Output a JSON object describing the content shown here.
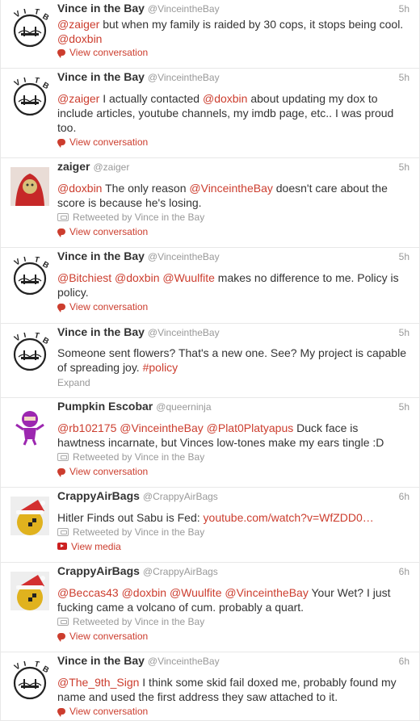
{
  "tweets": [
    {
      "name": "Vince in the Bay",
      "handle": "@VinceintheBay",
      "time": "5h",
      "avatar": "vitb-logo",
      "segments": [
        {
          "t": "mention",
          "v": "@zaiger"
        },
        {
          "t": "text",
          "v": " but when my family is raided by 30 cops, it stops being cool. "
        },
        {
          "t": "mention",
          "v": "@doxbin"
        }
      ],
      "action": "View conversation"
    },
    {
      "name": "Vince in the Bay",
      "handle": "@VinceintheBay",
      "time": "5h",
      "avatar": "vitb-logo",
      "segments": [
        {
          "t": "mention",
          "v": "@zaiger"
        },
        {
          "t": "text",
          "v": "  I actually contacted "
        },
        {
          "t": "mention",
          "v": "@doxbin"
        },
        {
          "t": "text",
          "v": " about updating my dox to include articles, youtube channels, my imdb page, etc.. I was proud too."
        }
      ],
      "action": "View conversation"
    },
    {
      "name": "zaiger",
      "handle": "@zaiger",
      "time": "5h",
      "avatar": "photo-red-hood",
      "segments": [
        {
          "t": "mention",
          "v": "@doxbin"
        },
        {
          "t": "text",
          "v": " The only reason "
        },
        {
          "t": "mention",
          "v": "@VinceintheBay"
        },
        {
          "t": "text",
          "v": " doesn't care about the score is because he's losing."
        }
      ],
      "retweeted": "Retweeted by Vince in the Bay",
      "action": "View conversation"
    },
    {
      "name": "Vince in the Bay",
      "handle": "@VinceintheBay",
      "time": "5h",
      "avatar": "vitb-logo",
      "segments": [
        {
          "t": "mention",
          "v": "@Bitchiest"
        },
        {
          "t": "text",
          "v": " "
        },
        {
          "t": "mention",
          "v": "@doxbin"
        },
        {
          "t": "text",
          "v": " "
        },
        {
          "t": "mention",
          "v": "@Wuulfite"
        },
        {
          "t": "text",
          "v": " makes no difference to me. Policy is policy."
        }
      ],
      "action": "View conversation"
    },
    {
      "name": "Vince in the Bay",
      "handle": "@VinceintheBay",
      "time": "5h",
      "avatar": "vitb-logo",
      "segments": [
        {
          "t": "text",
          "v": "Someone sent flowers? That's a new one. See? My project is capable of spreading joy.  "
        },
        {
          "t": "hashtag",
          "v": "#policy"
        }
      ],
      "expand": "Expand"
    },
    {
      "name": "Pumpkin Escobar",
      "handle": "@queerninja",
      "time": "5h",
      "avatar": "ninja-cartoon",
      "segments": [
        {
          "t": "mention",
          "v": "@rb102175"
        },
        {
          "t": "text",
          "v": " "
        },
        {
          "t": "mention",
          "v": "@VinceintheBay"
        },
        {
          "t": "text",
          "v": " "
        },
        {
          "t": "mention",
          "v": "@Plat0Platyapus"
        },
        {
          "t": "text",
          "v": " Duck face is hawtness incarnate, but Vinces low-tones make my ears tingle :D"
        }
      ],
      "retweeted": "Retweeted by Vince in the Bay",
      "action": "View conversation"
    },
    {
      "name": "CrappyAirBags",
      "handle": "@CrappyAirBags",
      "time": "6h",
      "avatar": "santa-dummy",
      "segments": [
        {
          "t": "text",
          "v": "Hitler Finds out Sabu is Fed: "
        },
        {
          "t": "link",
          "v": "youtube.com/watch?v=WfZDD0…"
        }
      ],
      "retweeted": "Retweeted by Vince in the Bay",
      "action": "View media",
      "action_icon": "play-icon"
    },
    {
      "name": "CrappyAirBags",
      "handle": "@CrappyAirBags",
      "time": "6h",
      "avatar": "santa-dummy",
      "segments": [
        {
          "t": "mention",
          "v": "@Beccas43"
        },
        {
          "t": "text",
          "v": " "
        },
        {
          "t": "mention",
          "v": "@doxbin"
        },
        {
          "t": "text",
          "v": " "
        },
        {
          "t": "mention",
          "v": "@Wuulfite"
        },
        {
          "t": "text",
          "v": " "
        },
        {
          "t": "mention",
          "v": "@VinceintheBay"
        },
        {
          "t": "text",
          "v": " Your Wet? I just fucking came a volcano of cum. probably a quart."
        }
      ],
      "retweeted": "Retweeted by Vince in the Bay",
      "action": "View conversation"
    },
    {
      "name": "Vince in the Bay",
      "handle": "@VinceintheBay",
      "time": "6h",
      "avatar": "vitb-logo",
      "segments": [
        {
          "t": "mention",
          "v": "@The_9th_Sign"
        },
        {
          "t": "text",
          "v": " I think some skid fail doxed me, probably found my name and used the first address they saw attached to it."
        }
      ],
      "action": "View conversation"
    }
  ],
  "logo_text": "VITB",
  "colors": {
    "link": "#cc3d2e",
    "meta": "#999999",
    "text": "#333333"
  }
}
